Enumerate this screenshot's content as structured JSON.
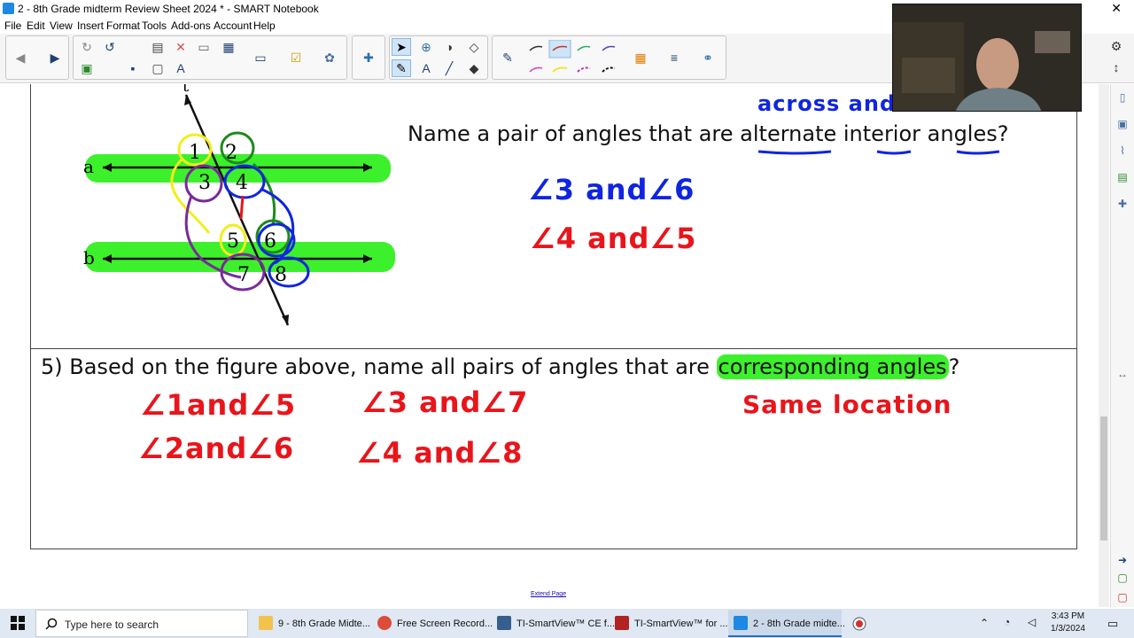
{
  "window": {
    "title": "2 - 8th Grade midterm Review Sheet 2024 * - SMART Notebook",
    "close_glyph": "✕"
  },
  "menu": [
    "File",
    "Edit",
    "View",
    "Insert",
    "Format",
    "Tools",
    "Add-ons",
    "Account",
    "Help"
  ],
  "question4": {
    "prompt": "Name a pair of angles that are alternate interior angles?",
    "annotation_top": "across and",
    "answer1": "∠3 and∠6",
    "answer2": "∠4 and∠5"
  },
  "figure": {
    "transversal_label": "t",
    "line_a_label": "a",
    "line_b_label": "b",
    "angles": [
      "1",
      "2",
      "3",
      "4",
      "5",
      "6",
      "7",
      "8"
    ]
  },
  "question5": {
    "prompt_prefix": "5) Based on the figure above, name all pairs of angles that are ",
    "prompt_highlight": "corresponding angles",
    "prompt_suffix": "?",
    "note": "Same location",
    "pairs": [
      "∠1and∠5",
      "∠3 and∠7",
      "∠2and∠6",
      "∠4 and∠8"
    ]
  },
  "extend_page": "Extend Page",
  "taskbar": {
    "search_placeholder": "Type here to search",
    "tasks": [
      {
        "label": "9 - 8th Grade Midte...",
        "color": "#f2c14e"
      },
      {
        "label": "Free Screen Record...",
        "color": "#dd4b39"
      },
      {
        "label": "TI-SmartView™ CE f...",
        "color": "#355f8c"
      },
      {
        "label": "TI-SmartView™ for ...",
        "color": "#b22222"
      },
      {
        "label": "2 - 8th Grade midte...",
        "color": "#1e88e5"
      }
    ],
    "time": "3:43 PM",
    "date": "1/3/2024"
  },
  "colors": {
    "highlight_green": "#3df02c",
    "ink_blue": "#1025e0",
    "ink_red": "#e8151b",
    "ink_yellow": "#f2ee1a",
    "ink_purple": "#7a2a9b",
    "ink_darkgreen": "#1d8a1d"
  }
}
